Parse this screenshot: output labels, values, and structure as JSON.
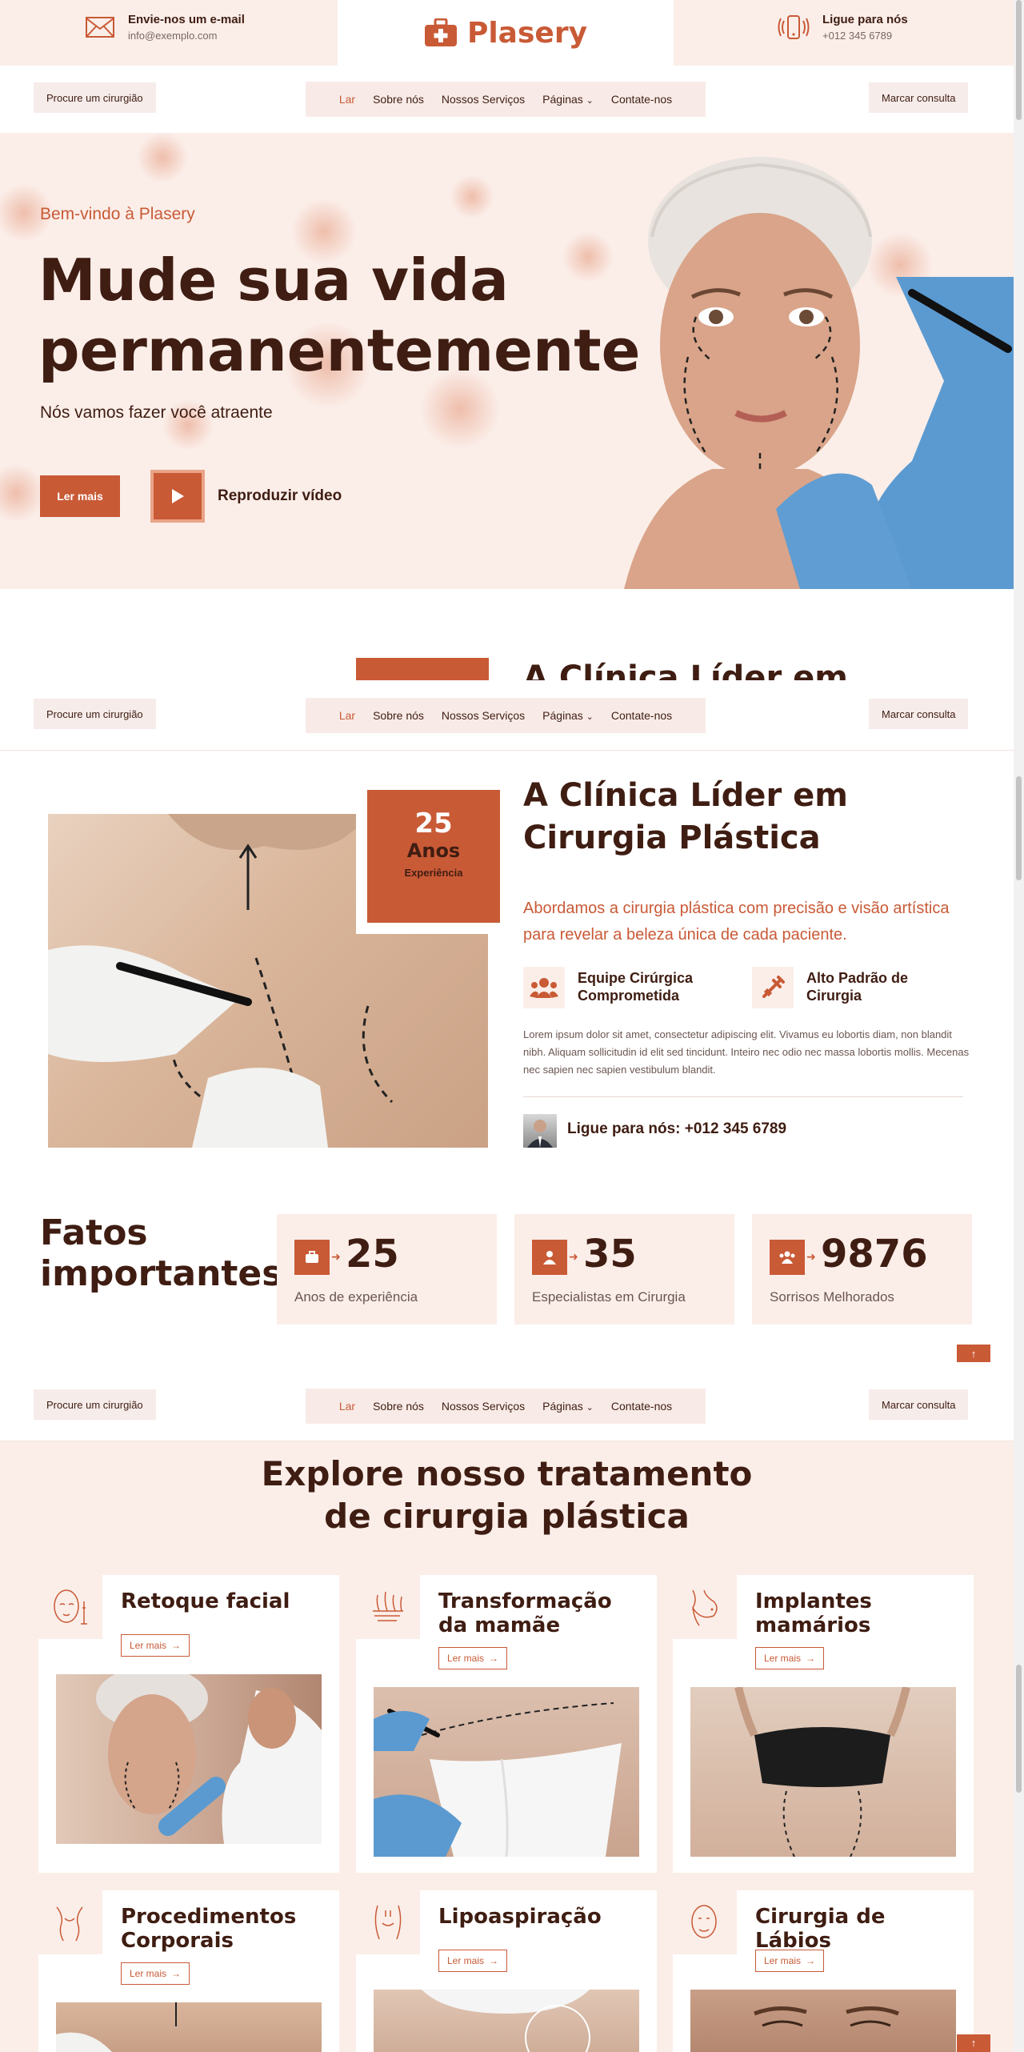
{
  "topbar": {
    "email_title": "Envie-nos um e-mail",
    "email_value": "info@exemplo.com",
    "brand": "Plasery",
    "phone_title": "Ligue para nós",
    "phone_value": "+012 345 6789"
  },
  "nav": {
    "find_surgeon": "Procure um cirurgião",
    "links": [
      "Lar",
      "Sobre nós",
      "Nossos Serviços",
      "Páginas",
      "Contate-nos"
    ],
    "book": "Marcar consulta"
  },
  "hero": {
    "welcome": "Bem-vindo à Plasery",
    "title_line1": "Mude sua vida",
    "title_line2": "permanentemente",
    "subtitle": "Nós vamos fazer você atraente",
    "read_more": "Ler mais",
    "play_video": "Reproduzir vídeo"
  },
  "about": {
    "peek_title": "A Clínica Líder em",
    "years_num": "25",
    "years_label": "Anos",
    "years_sub": "Experiência",
    "title_line1": "A Clínica Líder em",
    "title_line2": "Cirurgia Plástica",
    "lead": "Abordamos a cirurgia plástica com precisão e visão artística para revelar a beleza única de cada paciente.",
    "feature1": "Equipe Cirúrgica Comprometida",
    "feature2": "Alto Padrão de Cirurgia",
    "body": "Lorem ipsum dolor sit amet, consectetur adipiscing elit. Vivamus eu lobortis diam, non blandit nibh. Aliquam sollicitudin id elit sed tincidunt. Inteiro nec odio nec massa lobortis mollis. Mecenas nec sapien nec sapien vestibulum blandit.",
    "call": "Ligue para nós: +012 345 6789"
  },
  "facts": {
    "title_line1": "Fatos",
    "title_line2": "importantes",
    "items": [
      {
        "num": "25",
        "label": "Anos de experiência"
      },
      {
        "num": "35",
        "label": "Especialistas em Cirurgia"
      },
      {
        "num": "9876",
        "label": "Sorrisos Melhorados"
      }
    ]
  },
  "services": {
    "title_line1": "Explore nosso tratamento",
    "title_line2": "de cirurgia plástica",
    "read_more": "Ler mais",
    "cards": [
      {
        "title": "Retoque facial"
      },
      {
        "title": "Transformação da mamãe"
      },
      {
        "title": "Implantes mamários"
      },
      {
        "title": "Procedimentos Corporais"
      },
      {
        "title": "Lipoaspiração"
      },
      {
        "title": "Cirurgia de Lábios"
      }
    ]
  },
  "colors": {
    "accent": "#c95a36",
    "dark": "#3f1d12",
    "blush": "#fbeee9"
  }
}
